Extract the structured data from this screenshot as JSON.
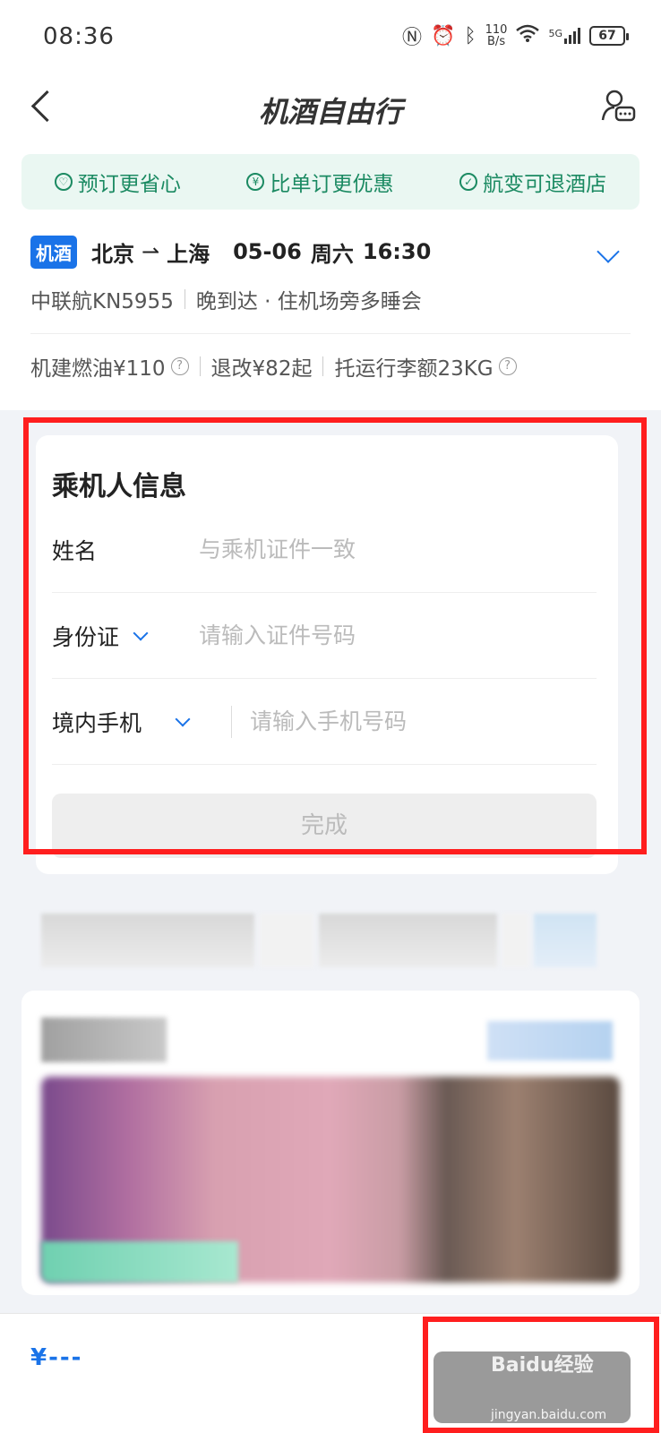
{
  "status_bar": {
    "time": "08:36",
    "net_speed_value": "110",
    "net_speed_unit": "B/s",
    "signal_label": "5G",
    "battery": "67"
  },
  "nav": {
    "title": "机酒自由行"
  },
  "benefits": [
    {
      "label": "预订更省心",
      "icon": "heart-shield-icon"
    },
    {
      "label": "比单订更优惠",
      "icon": "yen-circle-icon"
    },
    {
      "label": "航变可退酒店",
      "icon": "shield-check-icon"
    }
  ],
  "flight": {
    "tag": "机酒",
    "from": "北京",
    "to": "上海",
    "arrow": "⇀",
    "date": "05-06",
    "weekday": "周六",
    "time": "16:30",
    "airline": "中联航KN5955",
    "arrival_note": "晚到达 · 住机场旁多睡会",
    "fee": "机建燃油¥110",
    "change": "退改¥82起",
    "baggage": "托运行李额23KG"
  },
  "passenger": {
    "title": "乘机人信息",
    "name_label": "姓名",
    "name_placeholder": "与乘机证件一致",
    "id_label": "身份证",
    "id_placeholder": "请输入证件号码",
    "phone_label": "境内手机",
    "phone_placeholder": "请输入手机号码",
    "submit": "完成"
  },
  "bottom": {
    "price": "¥---",
    "watermark": "Baidu经验",
    "watermark_url": "jingyan.baidu.com"
  },
  "colors": {
    "accent": "#1a73e8",
    "benefit_green": "#1b8a62",
    "highlight_red": "#ff1e1e"
  }
}
